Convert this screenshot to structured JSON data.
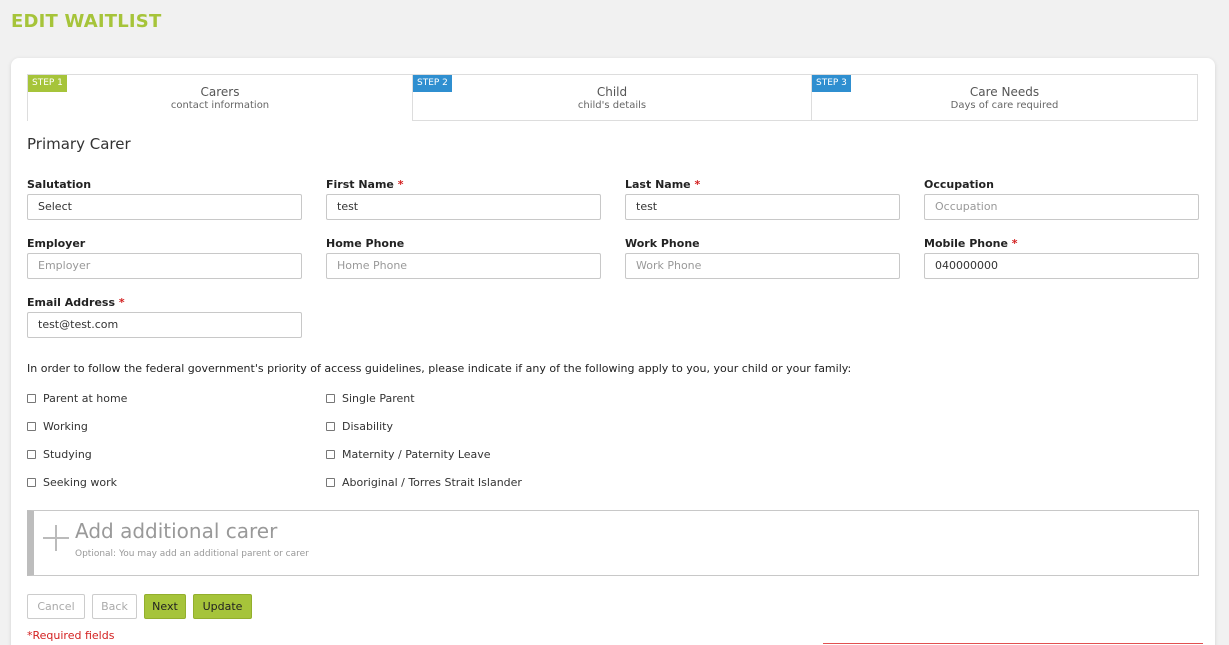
{
  "page": {
    "title": "EDIT WAITLIST"
  },
  "steps": [
    {
      "badge": "STEP 1",
      "title": "Carers",
      "subtitle": "contact information",
      "color": "#a6c43a"
    },
    {
      "badge": "STEP 2",
      "title": "Child",
      "subtitle": "child's details",
      "color": "#2f8fd0"
    },
    {
      "badge": "STEP 3",
      "title": "Care Needs",
      "subtitle": "Days of care required",
      "color": "#2f8fd0"
    }
  ],
  "primary_carer": {
    "title": "Primary Carer",
    "salutation": {
      "label": "Salutation",
      "value": "Select"
    },
    "first_name": {
      "label": "First Name",
      "required": "*",
      "value": "test"
    },
    "last_name": {
      "label": "Last Name",
      "required": "*",
      "value": "test"
    },
    "occupation": {
      "label": "Occupation",
      "placeholder": "Occupation"
    },
    "employer": {
      "label": "Employer",
      "placeholder": "Employer"
    },
    "home_phone": {
      "label": "Home Phone",
      "placeholder": "Home Phone"
    },
    "work_phone": {
      "label": "Work Phone",
      "placeholder": "Work Phone"
    },
    "mobile_phone": {
      "label": "Mobile Phone",
      "required": "*",
      "value": "040000000"
    },
    "email": {
      "label": "Email Address",
      "required": "*",
      "value": "test@test.com"
    }
  },
  "priority": {
    "notice": "In order to follow the federal government's priority of access guidelines, please indicate if any of the following apply to you, your child or your family:",
    "options_left": [
      "Parent at home",
      "Working",
      "Studying",
      "Seeking work"
    ],
    "options_right": [
      "Single Parent",
      "Disability",
      "Maternity / Paternity Leave",
      "Aboriginal / Torres Strait Islander"
    ]
  },
  "additional_carer": {
    "title": "Add additional carer",
    "subtitle": "Optional: You may add an additional parent or carer"
  },
  "buttons": {
    "cancel": "Cancel",
    "back": "Back",
    "next": "Next",
    "update": "Update"
  },
  "required_note": "*Required fields",
  "colors": {
    "accent": "#a6c43a",
    "step_blue": "#2f8fd0",
    "required": "#d32020"
  }
}
